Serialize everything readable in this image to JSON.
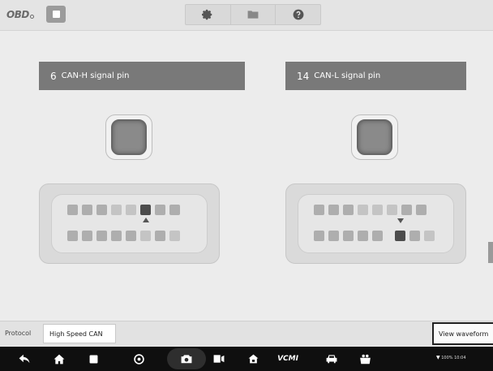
{
  "header": {
    "logo_text": "OBD",
    "toolbar_icons": [
      "gear-icon",
      "folder-icon",
      "help-icon"
    ]
  },
  "pins": {
    "left": {
      "number": "6",
      "label": "CAN-H signal pin"
    },
    "right": {
      "number": "14",
      "label": "CAN-L signal pin"
    }
  },
  "footer": {
    "protocol_label": "Protocol",
    "protocol_value": "High Speed CAN",
    "view_waveform_label": "View waveform"
  },
  "navbar": {
    "items": [
      "back-icon",
      "home-icon",
      "recent-apps-icon",
      "browser-icon",
      "camera-icon",
      "display-icon",
      "vehicle-home-icon",
      "vcmi-icon",
      "car-icon",
      "shop-icon"
    ],
    "vcmi_label": "VCMI",
    "status_text": "100% 10:04"
  },
  "colors": {
    "header_fill": "#797979",
    "active_pin": "#4c4c4c",
    "indicator": "#8a8a8a"
  }
}
